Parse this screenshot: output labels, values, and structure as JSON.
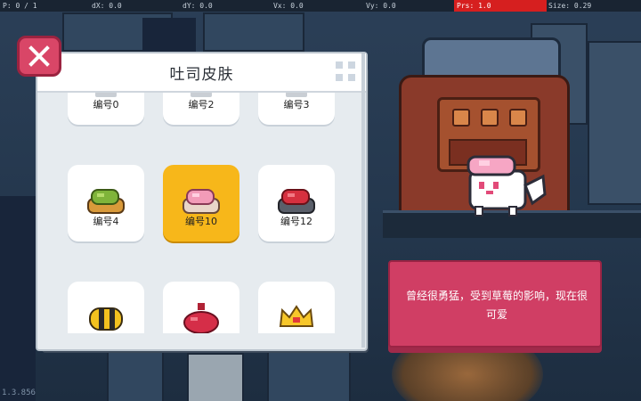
{
  "debug": {
    "p": "P: 0 / 1",
    "dx": "dX: 0.0",
    "dy": "dY: 0.0",
    "vx": "Vx: 0.0",
    "vy": "Vy: 0.0",
    "prs": "Prs: 1.0",
    "size": "Size: 0.29"
  },
  "version": "1.3.856",
  "dialog": {
    "title": "吐司皮肤"
  },
  "skins": [
    {
      "label": "编号0",
      "icon": "toast-icon-partial",
      "selected": false
    },
    {
      "label": "编号2",
      "icon": "toast-icon-partial",
      "selected": false
    },
    {
      "label": "编号3",
      "icon": "toast-icon-partial",
      "selected": false
    },
    {
      "label": "编号4",
      "icon": "green-toast-icon",
      "selected": false
    },
    {
      "label": "编号10",
      "icon": "pink-toast-icon",
      "selected": true
    },
    {
      "label": "编号12",
      "icon": "red-toast-icon",
      "selected": false
    },
    {
      "label": "",
      "icon": "bee-toast-icon",
      "selected": false
    },
    {
      "label": "",
      "icon": "red-bun-icon",
      "selected": false
    },
    {
      "label": "",
      "icon": "crown-toast-icon",
      "selected": false
    }
  ],
  "info": {
    "description": "曾经很勇猛，受到草莓的影响，现在很可爱"
  },
  "colors": {
    "selected_card": "#f7b71a",
    "close_button": "#d94667",
    "info_box": "#d03e64"
  }
}
